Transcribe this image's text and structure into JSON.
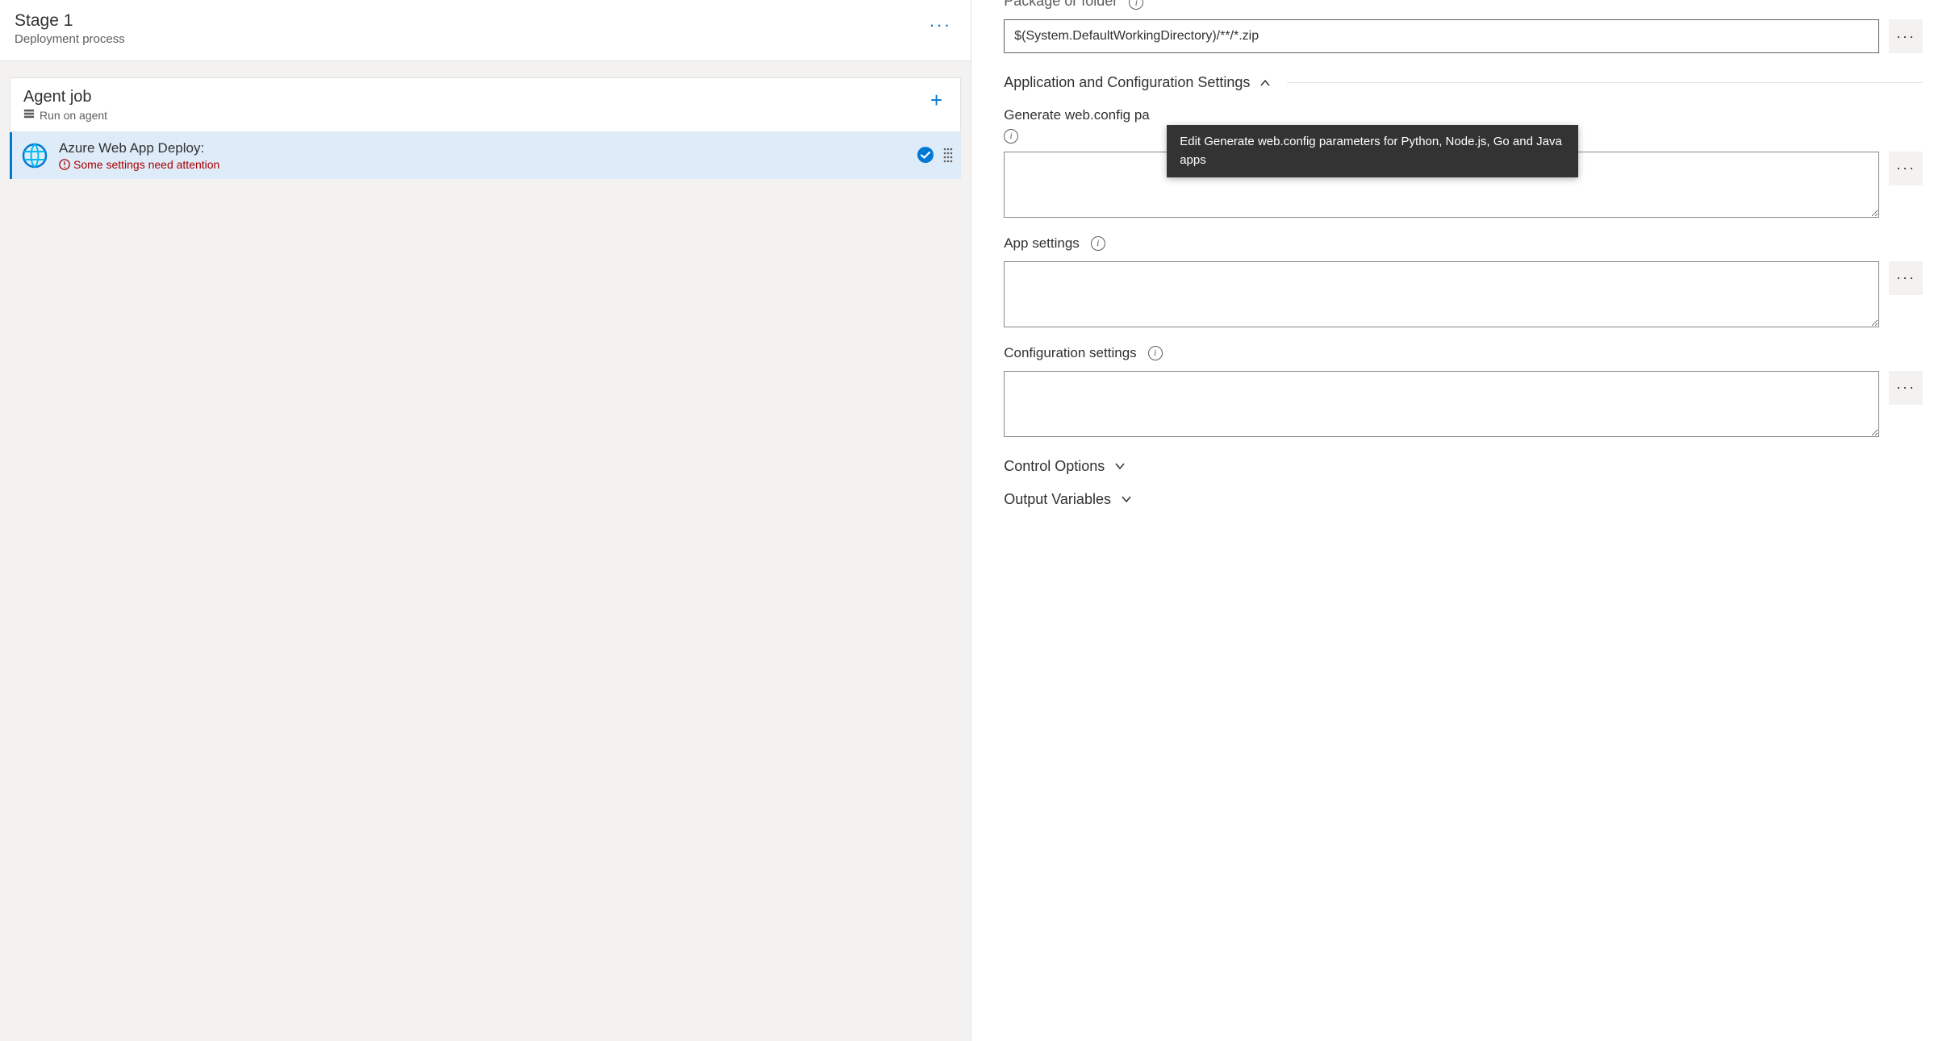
{
  "stage": {
    "title": "Stage 1",
    "subtitle": "Deployment process"
  },
  "agent_job": {
    "title": "Agent job",
    "subtitle": "Run on agent"
  },
  "task": {
    "title": "Azure Web App Deploy:",
    "error": "Some settings need attention"
  },
  "form": {
    "package_label_cut": "Package or folder",
    "package_value": "$(System.DefaultWorkingDirectory)/**/*.zip",
    "app_config_section": "Application and Configuration Settings",
    "webconfig_label": "Generate web.config pa",
    "webconfig_value": "",
    "app_settings_label": "App settings",
    "app_settings_value": "",
    "config_settings_label": "Configuration settings",
    "config_settings_value": "",
    "control_options_section": "Control Options",
    "output_vars_section": "Output Variables"
  },
  "tooltip": "Edit Generate web.config parameters for Python, Node.js, Go and Java apps"
}
